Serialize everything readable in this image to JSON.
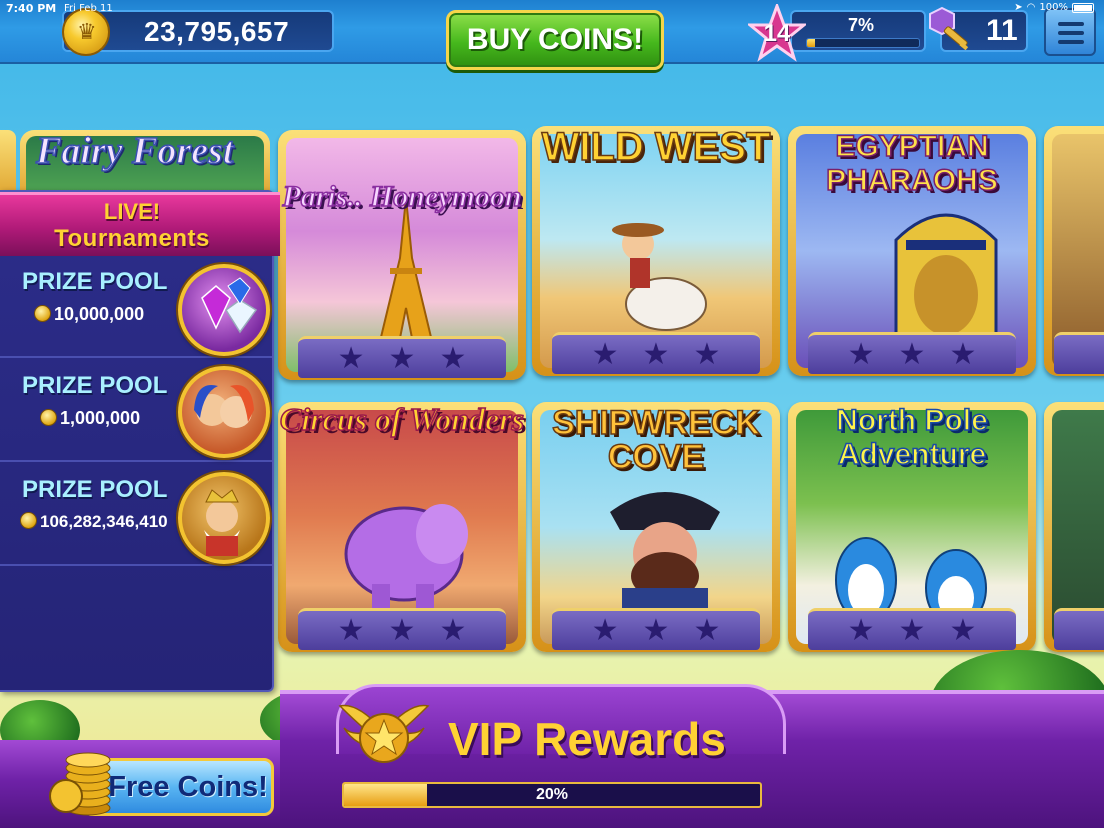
{
  "status_bar": {
    "time": "7:40 PM",
    "date": "Fri Feb 11",
    "battery": "100%"
  },
  "header": {
    "coin_balance": "23,795,657",
    "buy_coins_label": "BUY COINS!",
    "level": "14",
    "xp_percent": "7%",
    "xp_fraction": 0.07,
    "keys": "11",
    "icons": {
      "coin": "coin-icon",
      "level": "star-icon",
      "key": "key-icon",
      "menu": "hamburger-menu-icon"
    }
  },
  "tournaments": {
    "live_label": "LIVE!",
    "title": "Tournaments",
    "prize_label": "PRIZE POOL",
    "pools": [
      {
        "amount": "10,000,000",
        "badge": "gems"
      },
      {
        "amount": "1,000,000",
        "badge": "lovers"
      },
      {
        "amount": "106,282,346,410",
        "badge": "king"
      }
    ]
  },
  "slots": {
    "partial_left": {
      "title": "Fairy Forest"
    },
    "row1": [
      {
        "title": "Paris.. Honeymoon"
      },
      {
        "title": "WILD WEST"
      },
      {
        "title": "EGYPTIAN PHARAOHS"
      }
    ],
    "row2": [
      {
        "title": "Circus of Wonders"
      },
      {
        "title": "SHIPWRECK COVE"
      },
      {
        "title": "North Pole Adventure"
      }
    ],
    "star_glyph": "★"
  },
  "bottom": {
    "free_coins_label": "Free Coins!",
    "vip_title": "VIP Rewards",
    "vip_percent": "20%",
    "vip_fraction": 0.2
  },
  "colors": {
    "accent_gold": "#ffd233",
    "panel_navy": "#2c2d8a",
    "vip_purple": "#6f22a8",
    "buy_green": "#46b81d"
  }
}
